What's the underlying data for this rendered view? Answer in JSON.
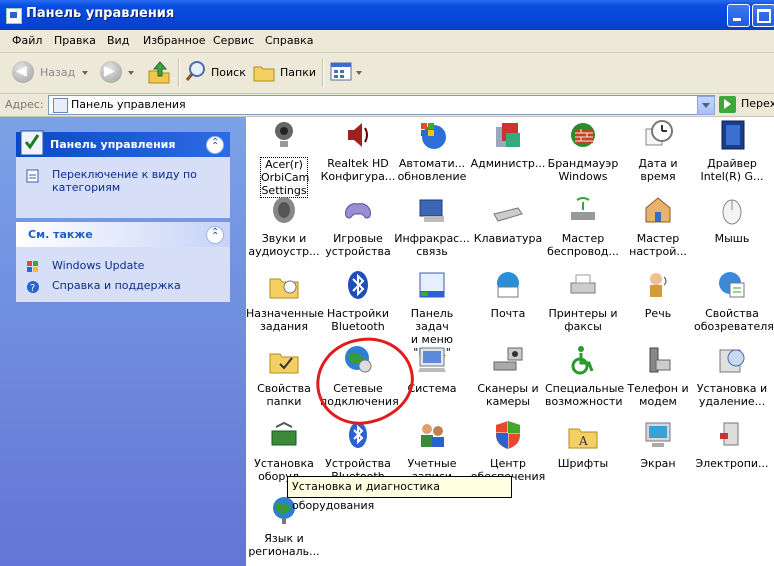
{
  "window": {
    "title": "Панель управления"
  },
  "menu": [
    "Файл",
    "Правка",
    "Вид",
    "Избранное",
    "Сервис",
    "Справка"
  ],
  "toolbar": {
    "back": "Назад",
    "search": "Поиск",
    "folders": "Папки"
  },
  "address": {
    "label": "Адрес:",
    "value": "Панель управления",
    "go": "Перех"
  },
  "left": {
    "panel_title": "Панель управления",
    "switch_view": [
      "Переключение к виду по",
      "категориям"
    ],
    "see_also_title": "См. также",
    "links": [
      "Windows Update",
      "Справка и поддержка"
    ]
  },
  "items": [
    [
      "Acer(r)",
      "OrbiCam",
      "Settings"
    ],
    [
      "Realtek HD",
      "Конфигура..."
    ],
    [
      "Автомати...",
      "обновление"
    ],
    [
      "Администр..."
    ],
    [
      "Брандмауэр",
      "Windows"
    ],
    [
      "Дата и время"
    ],
    [
      "Драйвер",
      "Intel(R) G..."
    ],
    [
      "Звуки и",
      "аудиоустр..."
    ],
    [
      "Игровые",
      "устройства"
    ],
    [
      "Инфракрас...",
      "связь"
    ],
    [
      "Клавиатура"
    ],
    [
      "Мастер",
      "беспровод..."
    ],
    [
      "Мастер",
      "настрой..."
    ],
    [
      "Мышь"
    ],
    [
      "Назначенные",
      "задания"
    ],
    [
      "Настройки",
      "Bluetooth"
    ],
    [
      "Панель задач",
      "и меню \"Пуск\""
    ],
    [
      "Почта"
    ],
    [
      "Принтеры и",
      "факсы"
    ],
    [
      "Речь"
    ],
    [
      "Свойства",
      "обозревателя"
    ],
    [
      "Свойства",
      "папки"
    ],
    [
      "Сетевые",
      "подключения"
    ],
    [
      "Система"
    ],
    [
      "Сканеры и",
      "камеры"
    ],
    [
      "Специальные",
      "возможности"
    ],
    [
      "Телефон и",
      "модем"
    ],
    [
      "Установка и",
      "удаление..."
    ],
    [
      "Установка",
      "оборуд..."
    ],
    [
      "Устройства",
      "Bluetooth"
    ],
    [
      "Учетные",
      "записи"
    ],
    [
      "Центр",
      "обеспечения"
    ],
    [
      "Шрифты"
    ],
    [
      "Экран"
    ],
    [
      "Электропи..."
    ],
    [
      "Язык и",
      "региональ..."
    ]
  ],
  "tooltip": "Установка и диагностика оборудования"
}
